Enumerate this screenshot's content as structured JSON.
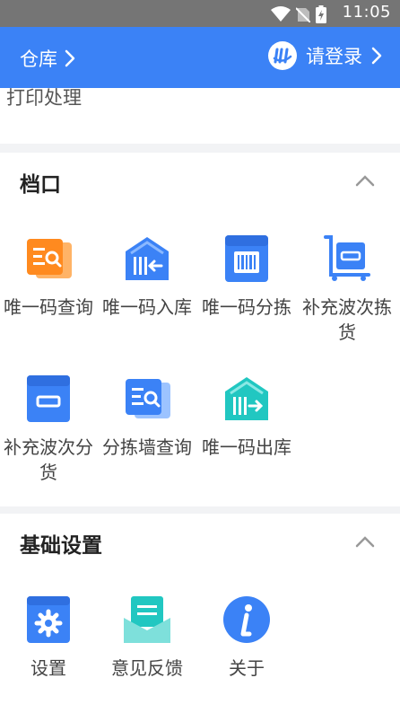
{
  "status": {
    "time": "11:05"
  },
  "header": {
    "warehouse": "仓库",
    "login": "请登录"
  },
  "top_card": {
    "text": "打印处理"
  },
  "section_dangkou": {
    "title": "档口",
    "items": [
      {
        "label": "唯一码查询"
      },
      {
        "label": "唯一码入库"
      },
      {
        "label": "唯一码分拣"
      },
      {
        "label": "补充波次拣货"
      },
      {
        "label": "补充波次分货"
      },
      {
        "label": "分拣墙查询"
      },
      {
        "label": "唯一码出库"
      }
    ]
  },
  "section_base": {
    "title": "基础设置",
    "items": [
      {
        "label": "设置"
      },
      {
        "label": "意见反馈"
      },
      {
        "label": "关于"
      }
    ]
  },
  "colors": {
    "primary": "#3b82f6",
    "orange": "#ff8a1f",
    "teal": "#21c7c1"
  }
}
